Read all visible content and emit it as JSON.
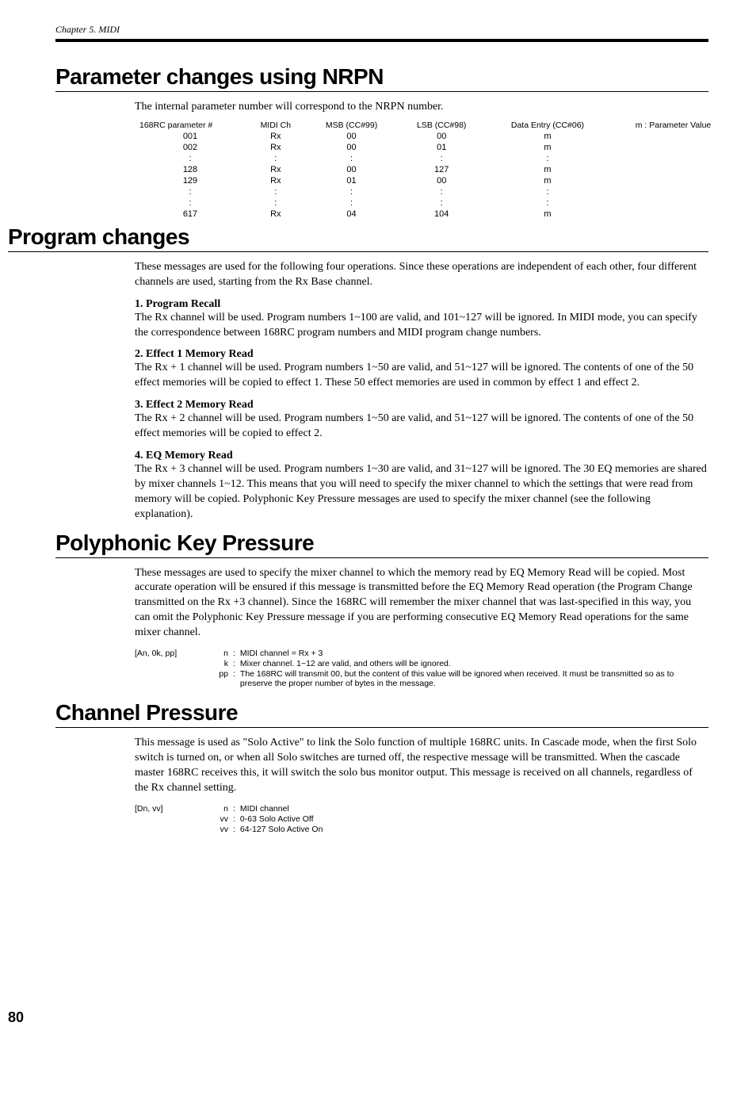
{
  "header": {
    "chapter": "Chapter 5. MIDI"
  },
  "s1": {
    "title": "Parameter changes using NRPN",
    "intro": "The internal parameter number will correspond to the NRPN number.",
    "table": {
      "h0": "168RC parameter #",
      "h1": "MIDI Ch",
      "h2": "MSB (CC#99)",
      "h3": "LSB (CC#98)",
      "h4": "Data Entry (CC#06)",
      "h5": "m : Parameter Value",
      "r1c0": "001",
      "r1c1": "Rx",
      "r1c2": "00",
      "r1c3": "00",
      "r1c4": "m",
      "r1c5": "",
      "r2c0": "002",
      "r2c1": "Rx",
      "r2c2": "00",
      "r2c3": "01",
      "r2c4": "m",
      "r2c5": "",
      "r3c0": ":",
      "r3c1": ":",
      "r3c2": ":",
      "r3c3": ":",
      "r3c4": ":",
      "r3c5": "",
      "r4c0": "128",
      "r4c1": "Rx",
      "r4c2": "00",
      "r4c3": "127",
      "r4c4": "m",
      "r4c5": "",
      "r5c0": "129",
      "r5c1": "Rx",
      "r5c2": "01",
      "r5c3": "00",
      "r5c4": "m",
      "r5c5": "",
      "r6c0": ":",
      "r6c1": ":",
      "r6c2": ":",
      "r6c3": ":",
      "r6c4": ":",
      "r6c5": "",
      "r7c0": ":",
      "r7c1": ":",
      "r7c2": ":",
      "r7c3": ":",
      "r7c4": ":",
      "r7c5": "",
      "r8c0": "617",
      "r8c1": "Rx",
      "r8c2": "04",
      "r8c3": "104",
      "r8c4": "m",
      "r8c5": ""
    }
  },
  "s2": {
    "title": "Program changes",
    "intro": "These messages are used for the following four operations. Since these operations are independent of each other, four different channels are used, starting from the Rx Base channel.",
    "sub1h": "1. Program Recall",
    "sub1t": "The Rx channel will be used. Program numbers 1~100 are valid, and 101~127 will be ignored. In MIDI mode, you can specify the correspondence between 168RC program numbers and MIDI program change numbers.",
    "sub2h": "2. Effect 1 Memory Read",
    "sub2t": "The Rx + 1 channel will be used. Program numbers 1~50 are valid, and 51~127 will be ignored. The contents of one of the 50 effect memories will be copied to effect 1. These 50 effect memories are used in common by effect 1 and effect 2.",
    "sub3h": "3. Effect 2 Memory Read",
    "sub3t": "The Rx + 2 channel will be used. Program numbers 1~50 are valid, and 51~127 will be ignored. The contents of one of the 50 effect memories will be copied to effect 2.",
    "sub4h": "4. EQ Memory Read",
    "sub4t": "The Rx + 3 channel will be used. Program numbers 1~30 are valid, and 31~127 will be ignored. The 30 EQ memories are shared by mixer channels 1~12. This means that you will need to specify the mixer channel to which the settings that were read from memory will be copied. Polyphonic Key Pressure messages are used to specify the mixer channel (see the following explanation)."
  },
  "s3": {
    "title": "Polyphonic Key Pressure",
    "intro": "These messages are used to specify the mixer channel to which the memory read by EQ Memory Read will be copied. Most accurate operation will be ensured if this message is transmitted before the EQ Memory Read operation (the Program Change transmitted on the Rx +3 channel). Since the 168RC will remember the mixer channel that was last-specified in this way, you can omit the Polyphonic Key Pressure message if you are performing consecutive EQ Memory Read operations for the same mixer channel.",
    "msg": "[An, 0k, pp]",
    "d1s": "n",
    "d1t": "MIDI channel = Rx + 3",
    "d2s": "k",
    "d2t": "Mixer channel. 1~12 are valid, and others will be ignored.",
    "d3s": "pp",
    "d3t": "The 168RC will transmit 00, but the content of this value will be ignored when received. It must be transmitted so as to preserve the proper number of bytes in the message."
  },
  "s4": {
    "title": "Channel Pressure",
    "intro": "This message is used as \"Solo Active\" to link the Solo function of multiple 168RC units. In Cascade mode, when the first Solo switch is turned on, or when all Solo switches are turned off, the respective message will be transmitted. When the cascade master 168RC receives this, it will switch the solo bus monitor output. This message is received on all channels, regardless of the Rx channel setting.",
    "msg": "[Dn, vv]",
    "d1s": "n",
    "d1t": "MIDI channel",
    "d2s": "vv",
    "d2t": "0-63 Solo Active Off",
    "d3s": "vv",
    "d3t": "64-127 Solo Active On"
  },
  "footer": {
    "page": "80"
  }
}
